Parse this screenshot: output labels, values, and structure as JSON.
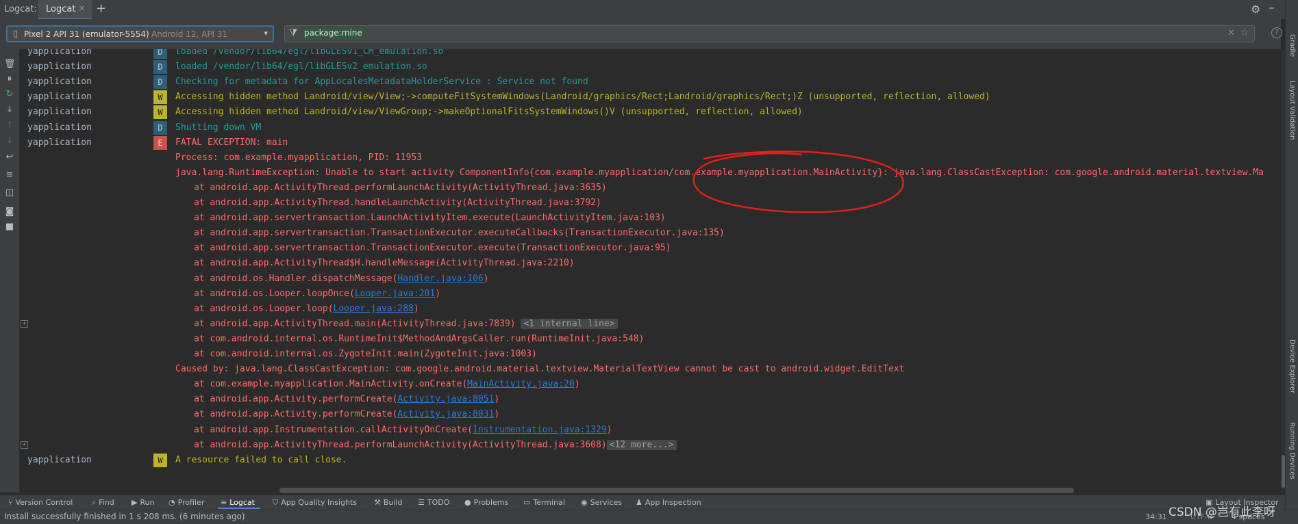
{
  "tool_window": {
    "label": "Logcat:",
    "tab": "Logcat",
    "tab_close": "×",
    "add_tab": "+"
  },
  "device": {
    "name": "Pixel 2 API 31 (emulator-5554)",
    "detail": "Android 12, API 31"
  },
  "filter": {
    "value": "package:mine",
    "placeholder": ""
  },
  "log_rows": [
    {
      "tag": "yapplication",
      "level": "D",
      "message": "loaded /vendor/lib64/egl/libGLESv1_CM_emulation.so"
    },
    {
      "tag": "yapplication",
      "level": "D",
      "message": "loaded /vendor/lib64/egl/libGLESv2_emulation.so"
    },
    {
      "tag": "yapplication",
      "level": "D",
      "message": "Checking for metadata for AppLocalesMetadataHolderService : Service not found"
    },
    {
      "tag": "yapplication",
      "level": "W",
      "message": "Accessing hidden method Landroid/view/View;->computeFitSystemWindows(Landroid/graphics/Rect;Landroid/graphics/Rect;)Z (unsupported, reflection, allowed)"
    },
    {
      "tag": "yapplication",
      "level": "W",
      "message": "Accessing hidden method Landroid/view/ViewGroup;->makeOptionalFitsSystemWindows()V (unsupported, reflection, allowed)"
    },
    {
      "tag": "yapplication",
      "level": "D",
      "message": "Shutting down VM"
    },
    {
      "tag": "yapplication",
      "level": "E",
      "message": "FATAL EXCEPTION: main"
    }
  ],
  "stacktrace": [
    {
      "indent": 0,
      "pre": "Process: com.example.myapplication, PID: 11953"
    },
    {
      "indent": 0,
      "pre": "java.lang.RuntimeException: Unable to start activity ComponentInfo{com.example.myapplication/com.example.myapplication.MainActivity}: java.lang.ClassCastException: com.google.android.material.textview.Ma"
    },
    {
      "indent": 1,
      "pre": "at android.app.ActivityThread.performLaunchActivity(ActivityThread.java:3635)"
    },
    {
      "indent": 1,
      "pre": "at android.app.ActivityThread.handleLaunchActivity(ActivityThread.java:3792)"
    },
    {
      "indent": 1,
      "pre": "at android.app.servertransaction.LaunchActivityItem.execute(LaunchActivityItem.java:103)"
    },
    {
      "indent": 1,
      "pre": "at android.app.servertransaction.TransactionExecutor.executeCallbacks(TransactionExecutor.java:135)"
    },
    {
      "indent": 1,
      "pre": "at android.app.servertransaction.TransactionExecutor.execute(TransactionExecutor.java:95)"
    },
    {
      "indent": 1,
      "pre": "at android.app.ActivityThread$H.handleMessage(ActivityThread.java:2210)"
    },
    {
      "indent": 1,
      "pre": "at android.os.Handler.dispatchMessage(",
      "link": "Handler.java:106",
      "post": ")"
    },
    {
      "indent": 1,
      "pre": "at android.os.Looper.loopOnce(",
      "link": "Looper.java:201",
      "post": ")"
    },
    {
      "indent": 1,
      "pre": "at android.os.Looper.loop(",
      "link": "Looper.java:288",
      "post": ")"
    },
    {
      "indent": 1,
      "pre": "at android.app.ActivityThread.main(ActivityThread.java:7839) ",
      "chip": "<1 internal line>",
      "fold": true
    },
    {
      "indent": 1,
      "pre": "at com.android.internal.os.RuntimeInit$MethodAndArgsCaller.run(RuntimeInit.java:548)"
    },
    {
      "indent": 1,
      "pre": "at com.android.internal.os.ZygoteInit.main(ZygoteInit.java:1003)"
    },
    {
      "indent": 0,
      "pre": "Caused by: java.lang.ClassCastException: com.google.android.material.textview.MaterialTextView cannot be cast to android.widget.EditText"
    },
    {
      "indent": 1,
      "pre": "at com.example.myapplication.MainActivity.onCreate(",
      "link": "MainActivity.java:20",
      "post": ")"
    },
    {
      "indent": 1,
      "pre": "at android.app.Activity.performCreate(",
      "link": "Activity.java:8051",
      "post": ")"
    },
    {
      "indent": 1,
      "pre": "at android.app.Activity.performCreate(",
      "link": "Activity.java:8031",
      "post": ")"
    },
    {
      "indent": 1,
      "pre": "at android.app.Instrumentation.callActivityOnCreate(",
      "link": "Instrumentation.java:1329",
      "post": ")"
    },
    {
      "indent": 1,
      "pre": "at android.app.ActivityThread.performLaunchActivity(ActivityThread.java:3608)",
      "chip": "<12 more...>",
      "fold": true
    }
  ],
  "last_row": {
    "tag": "yapplication",
    "level": "W",
    "message": "A resource failed to call close."
  },
  "bottom_tools": [
    "Version Control",
    "Find",
    "Run",
    "Profiler",
    "Logcat",
    "App Quality Insights",
    "Build",
    "TODO",
    "Problems",
    "Terminal",
    "Services",
    "App Inspection"
  ],
  "right_stripe": [
    "Gradle",
    "Layout Validation",
    "Device Explorer",
    "Running Devices"
  ],
  "layout_inspector": "Layout Inspector",
  "status": {
    "message": "Install successfully finished in 1 s 208 ms. (6 minutes ago)",
    "position": "34:31",
    "encoding": "UTF-8",
    "indent": "4 spaces"
  },
  "watermark": "CSDN @岂有此李呀",
  "colors": {
    "accent": "#4a88c7",
    "debug": "#299999",
    "warning": "#bbb529",
    "error": "#ff6b68",
    "annotation": "#e0201a"
  }
}
